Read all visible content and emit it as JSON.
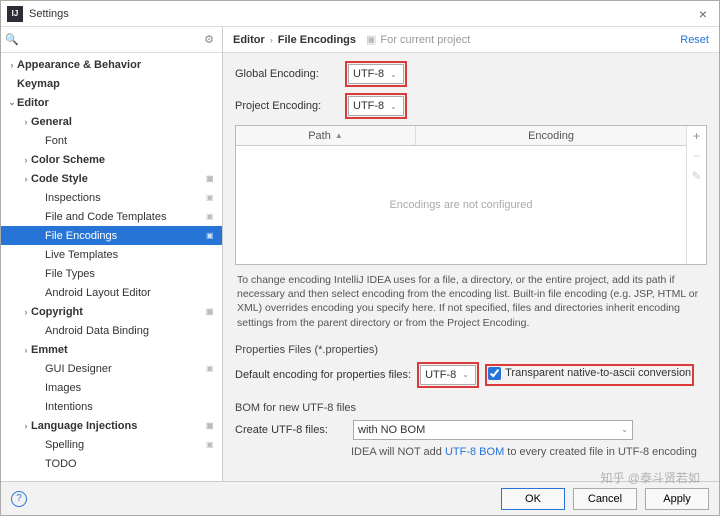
{
  "window": {
    "title": "Settings"
  },
  "search": {
    "placeholder": ""
  },
  "sidebar": {
    "items": [
      {
        "label": "Appearance & Behavior",
        "level": 0,
        "arrow": "›",
        "selected": false
      },
      {
        "label": "Keymap",
        "level": 0,
        "arrow": "",
        "selected": false
      },
      {
        "label": "Editor",
        "level": 0,
        "arrow": "⌄",
        "selected": false
      },
      {
        "label": "General",
        "level": 1,
        "arrow": "›",
        "selected": false
      },
      {
        "label": "Font",
        "level": 2,
        "arrow": "",
        "selected": false
      },
      {
        "label": "Color Scheme",
        "level": 1,
        "arrow": "›",
        "selected": false
      },
      {
        "label": "Code Style",
        "level": 1,
        "arrow": "›",
        "selected": false,
        "badge": true
      },
      {
        "label": "Inspections",
        "level": 2,
        "arrow": "",
        "selected": false,
        "badge": true
      },
      {
        "label": "File and Code Templates",
        "level": 2,
        "arrow": "",
        "selected": false,
        "badge": true
      },
      {
        "label": "File Encodings",
        "level": 2,
        "arrow": "",
        "selected": true,
        "badge": true
      },
      {
        "label": "Live Templates",
        "level": 2,
        "arrow": "",
        "selected": false
      },
      {
        "label": "File Types",
        "level": 2,
        "arrow": "",
        "selected": false
      },
      {
        "label": "Android Layout Editor",
        "level": 2,
        "arrow": "",
        "selected": false
      },
      {
        "label": "Copyright",
        "level": 1,
        "arrow": "›",
        "selected": false,
        "badge": true
      },
      {
        "label": "Android Data Binding",
        "level": 2,
        "arrow": "",
        "selected": false
      },
      {
        "label": "Emmet",
        "level": 1,
        "arrow": "›",
        "selected": false
      },
      {
        "label": "GUI Designer",
        "level": 2,
        "arrow": "",
        "selected": false,
        "badge": true
      },
      {
        "label": "Images",
        "level": 2,
        "arrow": "",
        "selected": false
      },
      {
        "label": "Intentions",
        "level": 2,
        "arrow": "",
        "selected": false
      },
      {
        "label": "Language Injections",
        "level": 1,
        "arrow": "›",
        "selected": false,
        "badge": true
      },
      {
        "label": "Spelling",
        "level": 2,
        "arrow": "",
        "selected": false,
        "badge": true
      },
      {
        "label": "TODO",
        "level": 2,
        "arrow": "",
        "selected": false
      }
    ]
  },
  "breadcrumb": {
    "a": "Editor",
    "b": "File Encodings",
    "hint": "For current project",
    "reset": "Reset"
  },
  "encodings": {
    "global_label": "Global Encoding:",
    "global_value": "UTF-8",
    "project_label": "Project Encoding:",
    "project_value": "UTF-8"
  },
  "table": {
    "col_path": "Path",
    "col_encoding": "Encoding",
    "empty": "Encodings are not configured"
  },
  "help_text": "To change encoding IntelliJ IDEA uses for a file, a directory, or the entire project, add its path if necessary and then select encoding from the encoding list. Built-in file encoding (e.g. JSP, HTML or XML) overrides encoding you specify here. If not specified, files and directories inherit encoding settings from the parent directory or from the Project Encoding.",
  "props": {
    "section": "Properties Files (*.properties)",
    "label": "Default encoding for properties files:",
    "value": "UTF-8",
    "checkbox": "Transparent native-to-ascii conversion"
  },
  "bom": {
    "section": "BOM for new UTF-8 files",
    "label": "Create UTF-8 files:",
    "value": "with NO BOM",
    "note_a": "IDEA will NOT add ",
    "note_link": "UTF-8 BOM",
    "note_b": " to every created file in UTF-8 encoding"
  },
  "footer": {
    "ok": "OK",
    "cancel": "Cancel",
    "apply": "Apply"
  },
  "watermark": "知乎 @泰斗贤若如"
}
